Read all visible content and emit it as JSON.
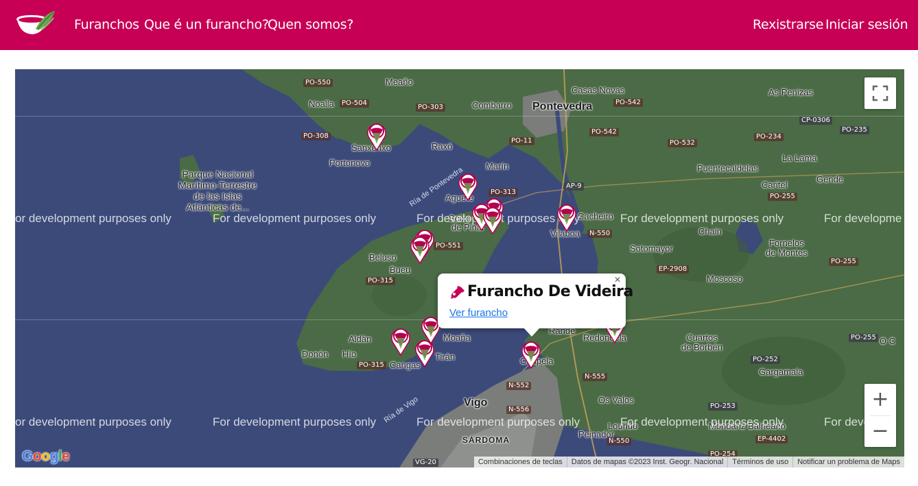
{
  "header": {
    "logo_name": "bowl-logo",
    "nav_left": [
      "Furanchos",
      "Que é un furancho?",
      "Quen somos?"
    ],
    "nav_right": [
      "Rexistrarse",
      "Iniciar sesión"
    ]
  },
  "map": {
    "watermark": "For development purposes only",
    "watermark_partial_left": "or development purposes only",
    "watermark_partial_right": "For developme",
    "watermark_partial_right2": "For deve",
    "place_labels": {
      "pontevedra": "Pontevedra",
      "vigo": "Vigo",
      "meano": "Meaño",
      "noalla": "Noalla",
      "combarro": "Combarro",
      "casas_novas": "Casas Novas",
      "as_penizas": "As Penizas",
      "sanxenxo": "Sanxenxo",
      "raxo": "Raxó",
      "portonovo": "Portonovo",
      "marin": "Marín",
      "la_lama": "La Lama",
      "puentecaldelas": "Puentecaldelas",
      "caritel": "Caritel",
      "gende": "Gende",
      "park": "Parque Nacional\nMarítimo-Terrestre\nde las Islas\nAtlánticas de...",
      "aguete": "Aguete",
      "seixo": "Seixo",
      "de_pinal": "de Pinal",
      "cacheiro": "Cacheiro",
      "vilaboa": "Vilaboa",
      "chain": "Chain",
      "sotomayor": "Sotomayor",
      "fornelos": "Fornelos\nde Montes",
      "beluso": "Beluso",
      "bueu": "Bueu",
      "moscoso": "Moscoso",
      "aldan": "Aldán",
      "moana": "Moaña",
      "rande": "Rande",
      "redondela": "Redondela",
      "cuartos": "Cuartos\nde Borbén",
      "o_c": "O C",
      "donon": "Donón",
      "hio": "Hío",
      "tiran": "Tirán",
      "cangas": "Cangas",
      "chapela": "Chapela",
      "gargamala": "Gargamala",
      "os_valos": "Os Valos",
      "peinador": "Peinador",
      "lourido": "Lourido",
      "mondariz": "Mondariz Balneario",
      "sardoma": "SÁRDOMA",
      "ria_pontevedra": "Ría de Pontevedra",
      "ria_vigo": "Ría de Vigo"
    },
    "roads": [
      "PO-550",
      "PO-504",
      "PO-303",
      "PO-542",
      "PO-308",
      "PO-11",
      "PO-542",
      "PO-532",
      "PO-234",
      "CP-0306",
      "PO-235",
      "PO-313",
      "AP-9",
      "PO-255",
      "PO-551",
      "N-550",
      "PO-315",
      "EP-2908",
      "PO-255",
      "PO-315",
      "PO-255",
      "N-555",
      "N-552",
      "PO-252",
      "N-556",
      "PO-253",
      "EP-4402",
      "N-550",
      "VG-20",
      "PO-254"
    ],
    "popup": {
      "title": "Furancho De Videira",
      "link": "Ver furancho",
      "close": "×",
      "icon": "wine-bottle-icon"
    },
    "controls": {
      "fullscreen_icon": "fullscreen-icon",
      "zoom_in": "+",
      "zoom_out": "−"
    },
    "attribution": [
      "Combinaciones de teclas",
      "Datos de mapas ©2023 Inst. Geogr. Nacional",
      "Términos de uso",
      "Notificar un problema de Maps"
    ],
    "google_logo": "Google"
  },
  "colors": {
    "brand": "#c80055",
    "water": "#3c4a7a",
    "land": "#4a6b45",
    "marker_ring": "#b4004f",
    "link": "#1a73e8"
  }
}
